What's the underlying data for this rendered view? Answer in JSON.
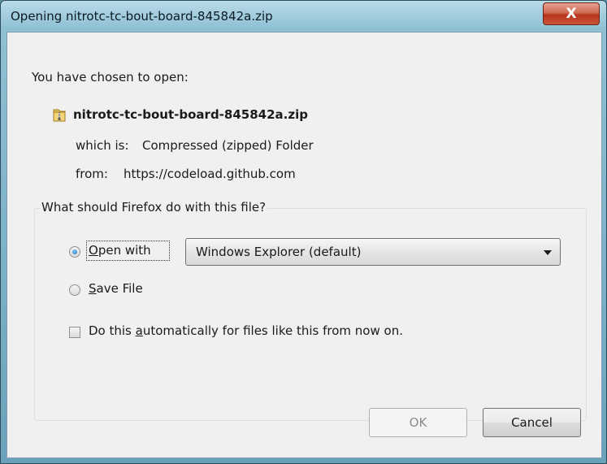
{
  "window": {
    "title": "Opening nitrotc-tc-bout-board-845842a.zip",
    "close_glyph": "X"
  },
  "intro": {
    "heading": "You have chosen to open:",
    "file_name": "nitrotc-tc-bout-board-845842a.zip",
    "file_icon": "zip-folder-icon",
    "which_is_label": "which is:",
    "which_is_value": "Compressed (zipped) Folder",
    "from_label": "from:",
    "from_value": "https://codeload.github.com"
  },
  "action_group": {
    "legend": "What should Firefox do with this file?",
    "open_with": {
      "label_first": "O",
      "label_rest": "pen with",
      "checked": true
    },
    "app_select": {
      "selected": "Windows Explorer (default)"
    },
    "save_file": {
      "label_first": "S",
      "label_rest": "ave File",
      "checked": false
    },
    "auto": {
      "label_before": "Do this ",
      "label_accel": "a",
      "label_after": "utomatically for files like this from now on.",
      "checked": false
    }
  },
  "buttons": {
    "ok": "OK",
    "cancel": "Cancel"
  }
}
